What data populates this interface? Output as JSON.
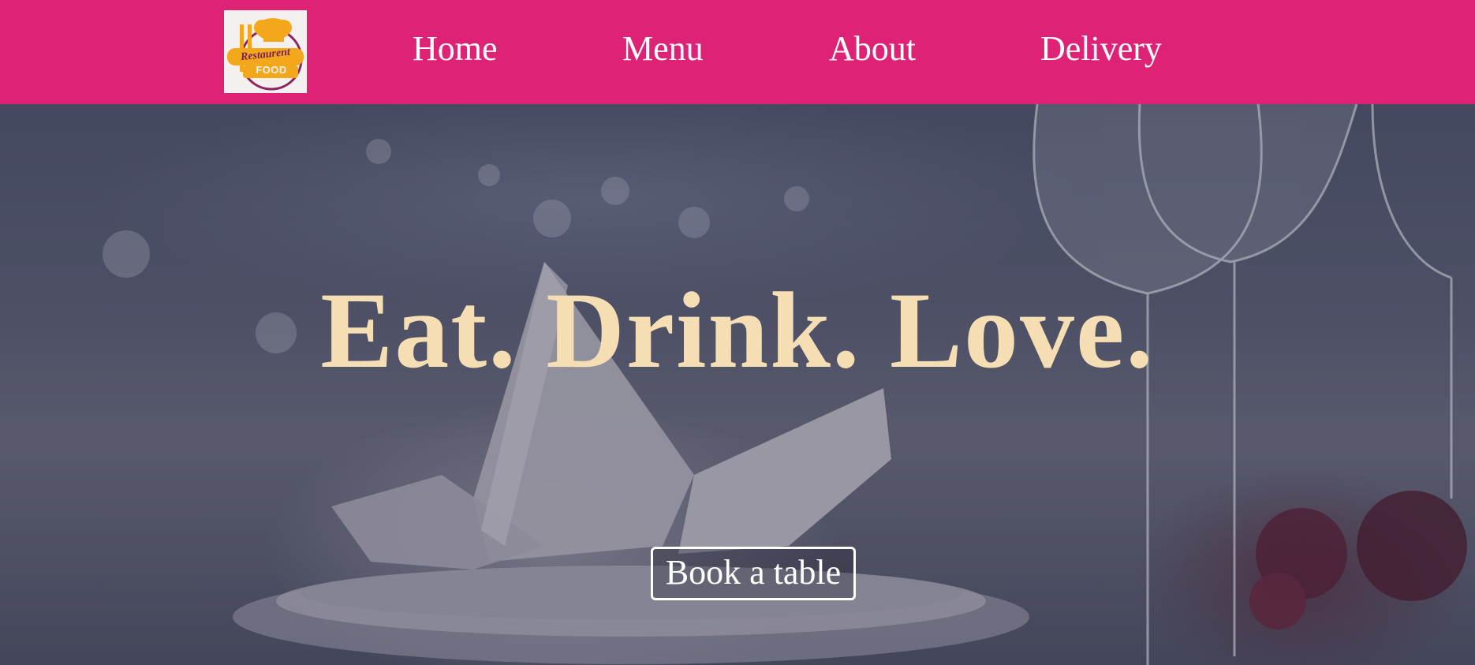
{
  "brand": {
    "logo_text_line1": "Restaurent",
    "logo_text_line2": "FOOD",
    "nav_color": "#de2377"
  },
  "nav": {
    "items": [
      {
        "label": "Home"
      },
      {
        "label": "Menu"
      },
      {
        "label": "About"
      },
      {
        "label": "Delivery"
      }
    ]
  },
  "hero": {
    "headline": "Eat. Drink. Love.",
    "cta_label": "Book a table",
    "headline_color": "#f5deb3"
  }
}
